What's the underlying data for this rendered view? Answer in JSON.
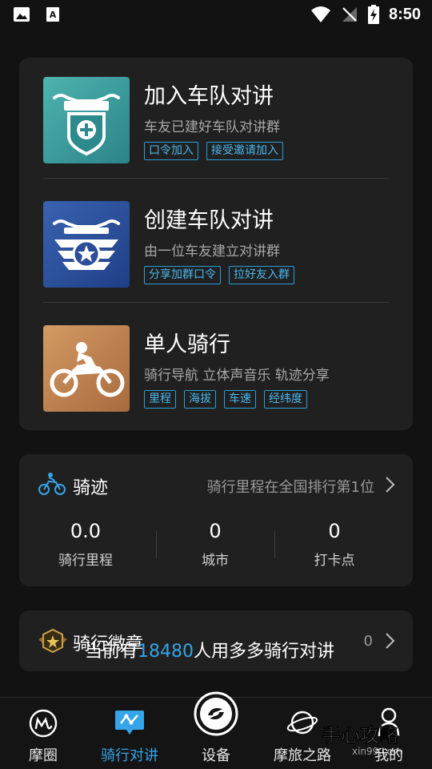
{
  "status_bar": {
    "time": "8:50"
  },
  "team_section": {
    "items": [
      {
        "title": "加入车队对讲",
        "desc": "车友已建好车队对讲群",
        "tags": [
          "口令加入",
          "接受邀请加入"
        ]
      },
      {
        "title": "创建车队对讲",
        "desc": "由一位车友建立对讲群",
        "tags": [
          "分享加群口令",
          "拉好友入群"
        ]
      },
      {
        "title": "单人骑行",
        "desc": "骑行导航 立体声音乐 轨迹分享",
        "tags": [
          "里程",
          "海拔",
          "车速",
          "经纬度"
        ]
      }
    ]
  },
  "trace": {
    "title": "骑迹",
    "rank_text": "骑行里程在全国排行第1位",
    "stats": [
      {
        "value": "0.0",
        "label": "骑行里程"
      },
      {
        "value": "0",
        "label": "城市"
      },
      {
        "value": "0",
        "label": "打卡点"
      }
    ]
  },
  "badge": {
    "title": "骑行微章",
    "count": "0"
  },
  "overlay": {
    "prefix": "当前有",
    "number": "18480",
    "suffix": "人用多多骑行对讲"
  },
  "nav": {
    "items": [
      {
        "label": "摩圈",
        "icon": "m-logo-icon"
      },
      {
        "label": "骑行对讲",
        "icon": "intercom-icon",
        "active": true
      },
      {
        "label": "设备",
        "icon": "device-icon"
      },
      {
        "label": "摩旅之路",
        "icon": "planet-icon"
      },
      {
        "label": "我的",
        "icon": "user-icon"
      }
    ]
  },
  "watermark": {
    "text": "手心攻略",
    "sub": "xin99.com"
  },
  "colors": {
    "accent": "#35a4e8",
    "card_bg": "#202020",
    "page_bg": "#121212"
  }
}
